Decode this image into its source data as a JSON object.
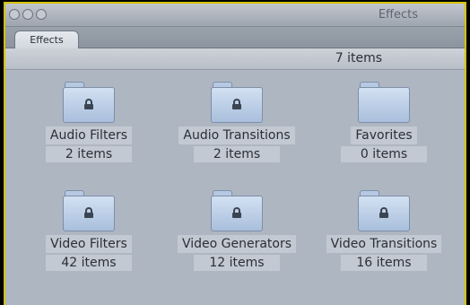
{
  "window": {
    "title": "Effects",
    "tab_label": "Effects",
    "item_count": "7 items"
  },
  "bins": [
    {
      "name": "Audio Filters",
      "count": "2 items",
      "locked": true
    },
    {
      "name": "Audio Transitions",
      "count": "2 items",
      "locked": true
    },
    {
      "name": "Favorites",
      "count": "0 items",
      "locked": false
    },
    {
      "name": "Video Filters",
      "count": "42 items",
      "locked": true
    },
    {
      "name": "Video Generators",
      "count": "12 items",
      "locked": true
    },
    {
      "name": "Video Transitions",
      "count": "16 items",
      "locked": true
    }
  ],
  "colors": {
    "window_border": "#d4c200",
    "content_bg": "#aeb6c1",
    "folder_fill": "#c4d6ee"
  }
}
